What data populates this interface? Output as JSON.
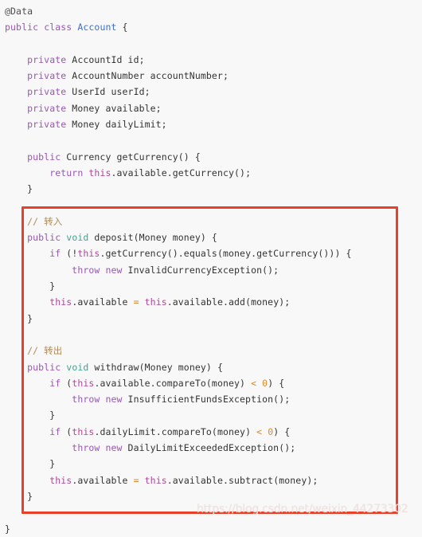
{
  "editor": {
    "background_color": "#f8f8f8",
    "language": "java",
    "font": "monospace"
  },
  "colors": {
    "keyword": "#9a56b5",
    "class_name": "#3b6fd4",
    "void_keyword": "#3aa98a",
    "this_keyword": "#b4459c",
    "number_operator": "#d98a2b",
    "plain_text": "#333333",
    "annotation": "#4d4d4d",
    "comment": "#b08a5a",
    "highlight_border": "#e8412a",
    "watermark": "#efe3e0"
  },
  "code": {
    "lines": [
      {
        "id": "l1",
        "indent": 0,
        "tokens": [
          {
            "t": "@Data",
            "c": "anno"
          }
        ]
      },
      {
        "id": "l2",
        "indent": 0,
        "tokens": [
          {
            "t": "public",
            "c": "kw"
          },
          {
            "t": " ",
            "c": "plain"
          },
          {
            "t": "class",
            "c": "kw"
          },
          {
            "t": " ",
            "c": "plain"
          },
          {
            "t": "Account",
            "c": "type"
          },
          {
            "t": " {",
            "c": "plain"
          }
        ]
      },
      {
        "id": "l3",
        "indent": 0,
        "tokens": []
      },
      {
        "id": "l4",
        "indent": 1,
        "tokens": [
          {
            "t": "private",
            "c": "kw"
          },
          {
            "t": " AccountId id;",
            "c": "plain"
          }
        ]
      },
      {
        "id": "l5",
        "indent": 1,
        "tokens": [
          {
            "t": "private",
            "c": "kw"
          },
          {
            "t": " AccountNumber accountNumber;",
            "c": "plain"
          }
        ]
      },
      {
        "id": "l6",
        "indent": 1,
        "tokens": [
          {
            "t": "private",
            "c": "kw"
          },
          {
            "t": " UserId userId;",
            "c": "plain"
          }
        ]
      },
      {
        "id": "l7",
        "indent": 1,
        "tokens": [
          {
            "t": "private",
            "c": "kw"
          },
          {
            "t": " Money available;",
            "c": "plain"
          }
        ]
      },
      {
        "id": "l8",
        "indent": 1,
        "tokens": [
          {
            "t": "private",
            "c": "kw"
          },
          {
            "t": " Money dailyLimit;",
            "c": "plain"
          }
        ]
      },
      {
        "id": "l9",
        "indent": 0,
        "tokens": []
      },
      {
        "id": "l10",
        "indent": 1,
        "tokens": [
          {
            "t": "public",
            "c": "kw"
          },
          {
            "t": " Currency getCurrency() {",
            "c": "plain"
          }
        ]
      },
      {
        "id": "l11",
        "indent": 2,
        "tokens": [
          {
            "t": "return",
            "c": "kw"
          },
          {
            "t": " ",
            "c": "plain"
          },
          {
            "t": "this",
            "c": "this"
          },
          {
            "t": ".available.getCurrency();",
            "c": "plain"
          }
        ]
      },
      {
        "id": "l12",
        "indent": 1,
        "tokens": [
          {
            "t": "}",
            "c": "plain"
          }
        ]
      },
      {
        "id": "l13",
        "indent": 0,
        "tokens": []
      },
      {
        "id": "l14",
        "indent": 1,
        "tokens": [
          {
            "t": "// 转入",
            "c": "cmt"
          }
        ]
      },
      {
        "id": "l15",
        "indent": 1,
        "tokens": [
          {
            "t": "public",
            "c": "kw"
          },
          {
            "t": " ",
            "c": "plain"
          },
          {
            "t": "void",
            "c": "vtype"
          },
          {
            "t": " deposit(Money money) {",
            "c": "plain"
          }
        ]
      },
      {
        "id": "l16",
        "indent": 2,
        "tokens": [
          {
            "t": "if",
            "c": "kw"
          },
          {
            "t": " (!",
            "c": "plain"
          },
          {
            "t": "this",
            "c": "this"
          },
          {
            "t": ".getCurrency().equals(money.getCurrency())) {",
            "c": "plain"
          }
        ]
      },
      {
        "id": "l17",
        "indent": 3,
        "tokens": [
          {
            "t": "throw",
            "c": "kw"
          },
          {
            "t": " ",
            "c": "plain"
          },
          {
            "t": "new",
            "c": "kw"
          },
          {
            "t": " InvalidCurrencyException();",
            "c": "plain"
          }
        ]
      },
      {
        "id": "l18",
        "indent": 2,
        "tokens": [
          {
            "t": "}",
            "c": "plain"
          }
        ]
      },
      {
        "id": "l19",
        "indent": 2,
        "tokens": [
          {
            "t": "this",
            "c": "this"
          },
          {
            "t": ".available ",
            "c": "plain"
          },
          {
            "t": "=",
            "c": "op"
          },
          {
            "t": " ",
            "c": "plain"
          },
          {
            "t": "this",
            "c": "this"
          },
          {
            "t": ".available.add(money);",
            "c": "plain"
          }
        ]
      },
      {
        "id": "l20",
        "indent": 1,
        "tokens": [
          {
            "t": "}",
            "c": "plain"
          }
        ]
      },
      {
        "id": "l21",
        "indent": 0,
        "tokens": []
      },
      {
        "id": "l22",
        "indent": 1,
        "tokens": [
          {
            "t": "// 转出",
            "c": "cmt"
          }
        ]
      },
      {
        "id": "l23",
        "indent": 1,
        "tokens": [
          {
            "t": "public",
            "c": "kw"
          },
          {
            "t": " ",
            "c": "plain"
          },
          {
            "t": "void",
            "c": "vtype"
          },
          {
            "t": " withdraw(Money money) {",
            "c": "plain"
          }
        ]
      },
      {
        "id": "l24",
        "indent": 2,
        "tokens": [
          {
            "t": "if",
            "c": "kw"
          },
          {
            "t": " (",
            "c": "plain"
          },
          {
            "t": "this",
            "c": "this"
          },
          {
            "t": ".available.compareTo(money) ",
            "c": "plain"
          },
          {
            "t": "<",
            "c": "op"
          },
          {
            "t": " ",
            "c": "plain"
          },
          {
            "t": "0",
            "c": "num"
          },
          {
            "t": ") {",
            "c": "plain"
          }
        ]
      },
      {
        "id": "l25",
        "indent": 3,
        "tokens": [
          {
            "t": "throw",
            "c": "kw"
          },
          {
            "t": " ",
            "c": "plain"
          },
          {
            "t": "new",
            "c": "kw"
          },
          {
            "t": " InsufficientFundsException();",
            "c": "plain"
          }
        ]
      },
      {
        "id": "l26",
        "indent": 2,
        "tokens": [
          {
            "t": "}",
            "c": "plain"
          }
        ]
      },
      {
        "id": "l27",
        "indent": 2,
        "tokens": [
          {
            "t": "if",
            "c": "kw"
          },
          {
            "t": " (",
            "c": "plain"
          },
          {
            "t": "this",
            "c": "this"
          },
          {
            "t": ".dailyLimit.compareTo(money) ",
            "c": "plain"
          },
          {
            "t": "<",
            "c": "op"
          },
          {
            "t": " ",
            "c": "plain"
          },
          {
            "t": "0",
            "c": "num"
          },
          {
            "t": ") {",
            "c": "plain"
          }
        ]
      },
      {
        "id": "l28",
        "indent": 3,
        "tokens": [
          {
            "t": "throw",
            "c": "kw"
          },
          {
            "t": " ",
            "c": "plain"
          },
          {
            "t": "new",
            "c": "kw"
          },
          {
            "t": " DailyLimitExceededException();",
            "c": "plain"
          }
        ]
      },
      {
        "id": "l29",
        "indent": 2,
        "tokens": [
          {
            "t": "}",
            "c": "plain"
          }
        ]
      },
      {
        "id": "l30",
        "indent": 2,
        "tokens": [
          {
            "t": "this",
            "c": "this"
          },
          {
            "t": ".available ",
            "c": "plain"
          },
          {
            "t": "=",
            "c": "op"
          },
          {
            "t": " ",
            "c": "plain"
          },
          {
            "t": "this",
            "c": "this"
          },
          {
            "t": ".available.subtract(money);",
            "c": "plain"
          }
        ]
      },
      {
        "id": "l31",
        "indent": 1,
        "tokens": [
          {
            "t": "}",
            "c": "plain"
          }
        ]
      },
      {
        "id": "l32",
        "indent": 0,
        "tokens": []
      },
      {
        "id": "l33",
        "indent": 0,
        "tokens": [
          {
            "t": "}",
            "c": "plain"
          }
        ]
      }
    ]
  },
  "highlight": {
    "label": "transfer-methods-highlight",
    "border_color": "#e8412a",
    "covers_lines": "// 转入 deposit(...) through withdraw(...) closing brace"
  },
  "watermark": {
    "text": "https://blog.csdn.net/weixin_44273302"
  }
}
